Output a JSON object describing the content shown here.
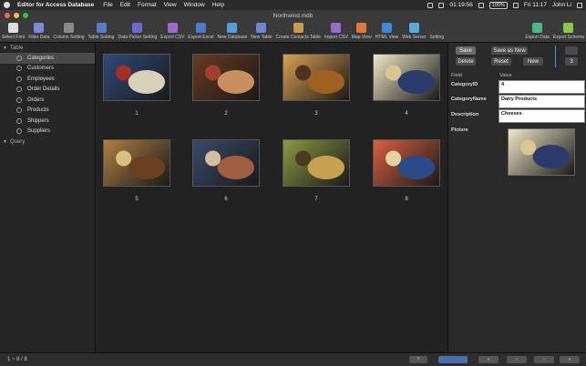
{
  "menubar": {
    "app_name": "Editor for Access Database",
    "menus": [
      "File",
      "Edit",
      "Format",
      "View",
      "Window",
      "Help"
    ],
    "time_small": "01:19:56",
    "battery": "100%",
    "clock": "Fri 11:17",
    "user": "John Li"
  },
  "window": {
    "title": "Northwind.mdb"
  },
  "toolbar": {
    "left": [
      {
        "label": "Select Font",
        "icon": "font-icon",
        "color": "#dddddd"
      },
      {
        "label": "Filter Data",
        "icon": "filter-icon",
        "color": "#7a8bd6"
      },
      {
        "label": "Column Setting",
        "icon": "columns-icon",
        "color": "#8a8a8a"
      },
      {
        "label": "Table Setting",
        "icon": "table-icon",
        "color": "#5a7bc8"
      },
      {
        "label": "Data Picker Setting",
        "icon": "picker-icon",
        "color": "#6a6ad0"
      },
      {
        "label": "Export CSV",
        "icon": "csv-icon",
        "color": "#9a6ad0"
      },
      {
        "label": "Export Excel",
        "icon": "excel-icon",
        "color": "#4a7ac8"
      },
      {
        "label": "New Database",
        "icon": "database-icon",
        "color": "#5a9ad8"
      },
      {
        "label": "New Table",
        "icon": "new-table-icon",
        "color": "#6a8ad0"
      },
      {
        "label": "Create Contacts Table",
        "icon": "contacts-icon",
        "color": "#c89a4a"
      },
      {
        "label": "Import CSV",
        "icon": "import-icon",
        "color": "#9a6ad0"
      },
      {
        "label": "Map View",
        "icon": "map-icon",
        "color": "#e07a3a"
      },
      {
        "label": "HTML View",
        "icon": "globe-icon",
        "color": "#3a8ae0"
      },
      {
        "label": "Web Server",
        "icon": "server-icon",
        "color": "#5aaad8"
      },
      {
        "label": "Setting",
        "icon": "gear-icon",
        "color": "#3a3a3a"
      }
    ],
    "right": [
      {
        "label": "Export Data",
        "icon": "export-icon",
        "color": "#4ab88a"
      },
      {
        "label": "Export Schema",
        "icon": "schema-icon",
        "color": "#8ac84a"
      }
    ]
  },
  "sidebar": {
    "table_group": "Table",
    "query_group": "Query",
    "items": [
      "Categories",
      "Customers",
      "Employees",
      "Order Details",
      "Orders",
      "Products",
      "Shippers",
      "Suppliers"
    ],
    "selected": "Categories"
  },
  "grid": {
    "items": [
      {
        "label": "1",
        "colors": [
          "#2e4a7a",
          "#d8d0b8",
          "#a03020"
        ]
      },
      {
        "label": "2",
        "colors": [
          "#6a3a20",
          "#c89060",
          "#a04030"
        ]
      },
      {
        "label": "3",
        "colors": [
          "#d8a050",
          "#a06020",
          "#503020"
        ]
      },
      {
        "label": "4",
        "colors": [
          "#f0e8c8",
          "#2a3a6a",
          "#d8c890"
        ]
      },
      {
        "label": "5",
        "colors": [
          "#b08040",
          "#6a4020",
          "#d8c080"
        ]
      },
      {
        "label": "6",
        "colors": [
          "#3a4a6a",
          "#a06040",
          "#d0c0a0"
        ]
      },
      {
        "label": "7",
        "colors": [
          "#8a9a40",
          "#c8a050",
          "#4a3a20"
        ]
      },
      {
        "label": "8",
        "colors": [
          "#d86040",
          "#2a4a8a",
          "#e8d0a0"
        ]
      }
    ]
  },
  "detail": {
    "buttons": {
      "save": "Save",
      "save_as_new": "Save as New",
      "delete": "Delete",
      "reset": "Reset",
      "new": "New",
      "page": "3"
    },
    "field_header": "Field",
    "value_header": "Value",
    "fields": [
      {
        "label": "CategoryID",
        "value": "4"
      },
      {
        "label": "CategoryName",
        "value": "Dairy Products"
      },
      {
        "label": "Description",
        "value": "Cheeses"
      }
    ],
    "picture_label": "Picture"
  },
  "statusbar": {
    "count": "1 ~ 8 / 8"
  }
}
